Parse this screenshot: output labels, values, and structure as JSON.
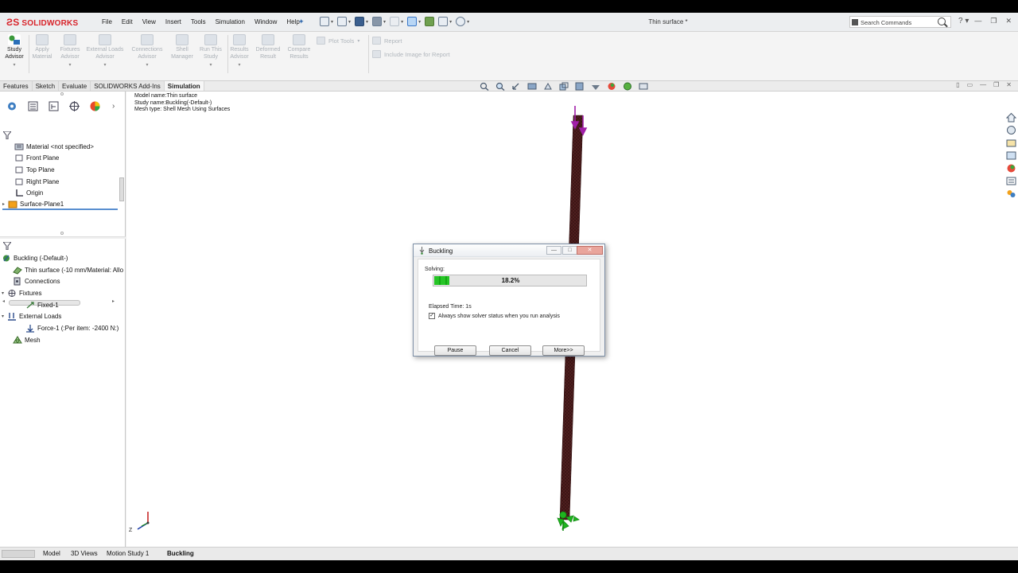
{
  "app": {
    "logo": "SOLIDWORKS",
    "document_title": "Thin surface *"
  },
  "menu": [
    "File",
    "Edit",
    "View",
    "Insert",
    "Tools",
    "Simulation",
    "Window",
    "Help"
  ],
  "search": {
    "label": "Search Commands"
  },
  "ribbon": {
    "study_advisor": "Study\nAdvisor",
    "buttons": [
      {
        "label": "Apply\nMaterial"
      },
      {
        "label": "Fixtures\nAdvisor"
      },
      {
        "label": "External Loads\nAdvisor"
      },
      {
        "label": "Connections\nAdvisor"
      },
      {
        "label": "Shell\nManager"
      },
      {
        "label": "Run This\nStudy"
      },
      {
        "label": "Results\nAdvisor"
      },
      {
        "label": "Deformed\nResult"
      },
      {
        "label": "Compare\nResults"
      }
    ],
    "plot_tools": "Plot Tools",
    "report": "Report",
    "include_image": "Include Image for Report"
  },
  "command_tabs": [
    "Features",
    "Sketch",
    "Evaluate",
    "SOLIDWORKS Add-Ins",
    "Simulation"
  ],
  "active_command_tab": "Simulation",
  "feature_tree": [
    {
      "label": "Material <not specified>"
    },
    {
      "label": "Front Plane"
    },
    {
      "label": "Top Plane"
    },
    {
      "label": "Right Plane"
    },
    {
      "label": "Origin"
    },
    {
      "label": "Surface-Plane1"
    }
  ],
  "sim_tree": {
    "study": "Buckling (-Default-)",
    "items": [
      {
        "label": "Thin surface (-10 mm/Material: Allo"
      },
      {
        "label": "Connections"
      },
      {
        "label": "Fixtures"
      },
      {
        "label": "Fixed-1"
      },
      {
        "label": "External Loads"
      },
      {
        "label": "Force-1 (:Per item: -2400 N:)"
      },
      {
        "label": "Mesh"
      }
    ]
  },
  "model_info": {
    "line1": "Model name:Thin surface",
    "line2": "Study name:Buckling(-Default-)",
    "line3": "Mesh type: Shell Mesh Using Surfaces"
  },
  "dialog": {
    "title": "Buckling",
    "solving_label": "Solving:",
    "progress_text": "18.2%",
    "progress_fraction": 0.182,
    "elapsed": "Elapsed Time: 1s",
    "checkbox_label": "Always show solver status when you run analysis",
    "checkbox_checked": true,
    "pause": "Pause",
    "cancel": "Cancel",
    "more": "More>>"
  },
  "axis_labels": {
    "z": "Z"
  },
  "bottom_tabs": [
    "Model",
    "3D Views",
    "Motion Study 1",
    "Buckling"
  ],
  "active_bottom_tab": "Buckling",
  "colors": {
    "beam": "#3a1414",
    "load_arrow": "#a11fa8",
    "fixture": "#1fb51f",
    "progress": "#26c426",
    "brand": "#d8232a"
  }
}
